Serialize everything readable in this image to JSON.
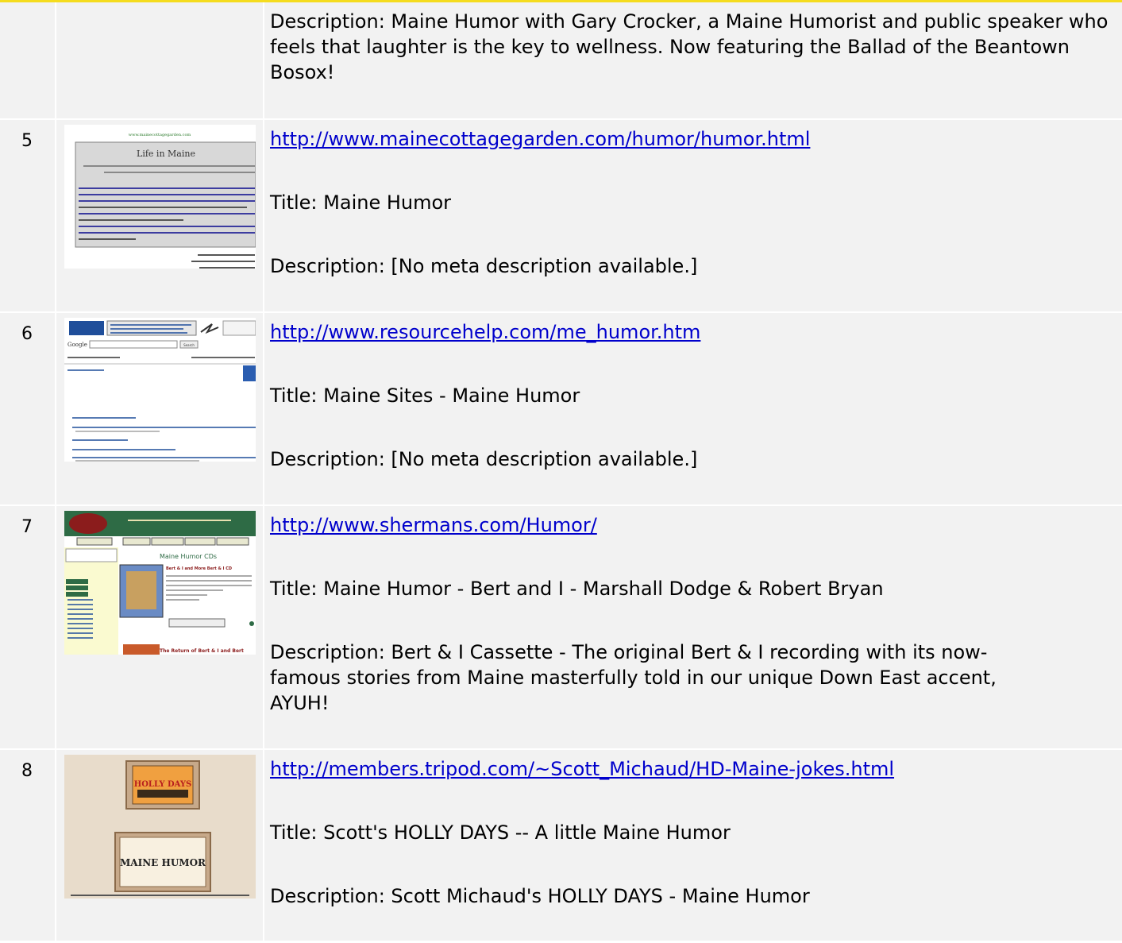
{
  "rows": [
    {
      "number": "",
      "url": "",
      "title": "",
      "description": "Description: Maine Humor with Gary Crocker, a Maine Humorist and public speaker who feels that laughter is the key to wellness. Now featuring the Ballad of the Beantown Bosox!"
    },
    {
      "number": "5",
      "url": "http://www.mainecottagegarden.com/humor/humor.html",
      "title": "Title: Maine Humor",
      "description": "Description: [No meta description available.]",
      "thumbnail": {
        "header_url": "www.mainecottagegarden.com",
        "heading": "Life in Maine"
      }
    },
    {
      "number": "6",
      "url": "http://www.resourcehelp.com/me_humor.htm",
      "title": "Title: Maine Sites - Maine Humor",
      "description": "Description: [No meta description available.]",
      "thumbnail": {
        "search_label": "Google",
        "search_button": "Search"
      }
    },
    {
      "number": "7",
      "url": "http://www.shermans.com/Humor/",
      "title": "Title: Maine Humor - Bert and I - Marshall Dodge & Robert Bryan",
      "description": "Description: Bert & I Cassette - The original Bert & I recording with its now-famous stories from Maine masterfully told in our unique Down East accent,  AYUH!",
      "thumbnail": {
        "heading": "Maine Humor CDs",
        "subheading": "Bert & I and More Bert & I CD",
        "footer": "The Return of Bert & I and Bert"
      }
    },
    {
      "number": "8",
      "url": "http://members.tripod.com/~Scott_Michaud/HD-Maine-jokes.html",
      "title": "Title: Scott's HOLLY DAYS -- A little Maine Humor",
      "description": "Description: Scott Michaud's HOLLY DAYS - Maine Humor",
      "thumbnail": {
        "top_sign": "HOLLY DAYS",
        "label": "MAINE HUMOR"
      }
    }
  ],
  "colors": {
    "accent_border": "#f5dc1e",
    "row_background": "#f2f2f2",
    "link": "#0000cc"
  }
}
